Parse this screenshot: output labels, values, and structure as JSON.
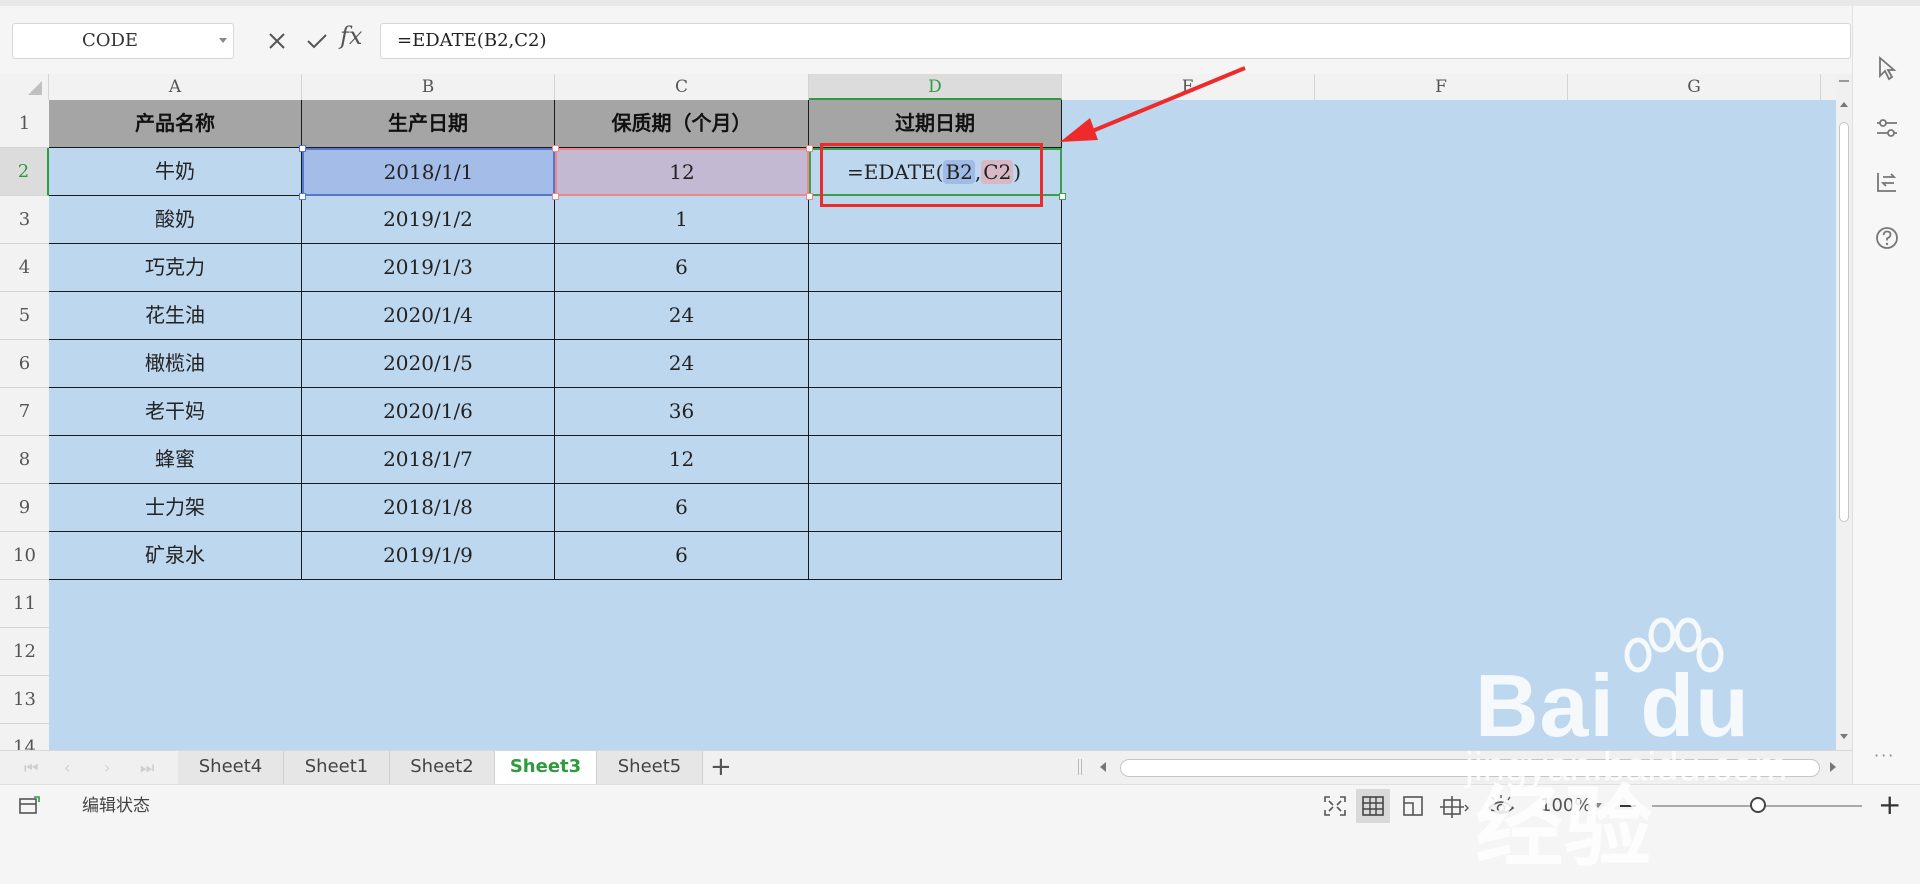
{
  "formula_bar": {
    "name_box": "CODE",
    "cancel_icon": "close-icon",
    "confirm_icon": "check-icon",
    "fx_label": "fx",
    "formula": "=EDATE(B2,C2)"
  },
  "columns": [
    "A",
    "B",
    "C",
    "D",
    "E",
    "F",
    "G"
  ],
  "rows": [
    "1",
    "2",
    "3",
    "4",
    "5",
    "6",
    "7",
    "8",
    "9",
    "10",
    "11",
    "12",
    "13",
    "14"
  ],
  "table": {
    "headers": [
      "产品名称",
      "生产日期",
      "保质期（个月）",
      "过期日期"
    ],
    "rows": [
      {
        "name": "牛奶",
        "date": "2018/1/1",
        "months": "12"
      },
      {
        "name": "酸奶",
        "date": "2019/1/2",
        "months": "1"
      },
      {
        "name": "巧克力",
        "date": "2019/1/3",
        "months": "6"
      },
      {
        "name": "花生油",
        "date": "2020/1/4",
        "months": "24"
      },
      {
        "name": "橄榄油",
        "date": "2020/1/5",
        "months": "24"
      },
      {
        "name": "老干妈",
        "date": "2020/1/6",
        "months": "36"
      },
      {
        "name": "蜂蜜",
        "date": "2018/1/7",
        "months": "12"
      },
      {
        "name": "士力架",
        "date": "2018/1/8",
        "months": "6"
      },
      {
        "name": "矿泉水",
        "date": "2019/1/9",
        "months": "6"
      }
    ]
  },
  "active_cell": {
    "prefix": "=EDATE(",
    "ref1": "B2",
    "sep": ",",
    "ref2": "C2",
    "suffix": ")"
  },
  "sheet_tabs": [
    "Sheet4",
    "Sheet1",
    "Sheet2",
    "Sheet3",
    "Sheet5"
  ],
  "active_sheet": "Sheet3",
  "status": {
    "mode": "编辑状态",
    "zoom": "100%"
  },
  "watermark": {
    "logo": "Bai du 经验",
    "url": "jingyan.baidu.com"
  },
  "colors": {
    "grid_bg": "#bdd7ee",
    "header_fill": "#a5a5a5",
    "accent": "#2e9b3e",
    "annotation": "#ef2a2a"
  }
}
